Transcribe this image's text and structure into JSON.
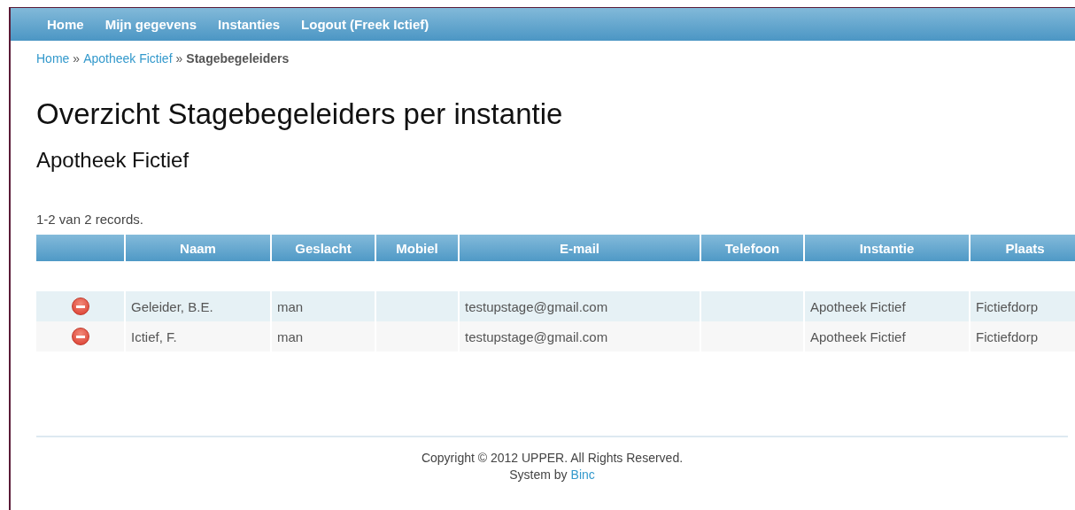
{
  "nav": [
    {
      "label": "Home"
    },
    {
      "label": "Mijn gegevens"
    },
    {
      "label": "Instanties"
    },
    {
      "label": "Logout (Freek Ictief)"
    }
  ],
  "breadcrumb": {
    "links": [
      "Home",
      "Apotheek Fictief"
    ],
    "separator": "»",
    "current": "Stagebegeleiders"
  },
  "title": "Overzicht Stagebegeleiders per instantie",
  "subtitle": "Apotheek Fictief",
  "summary": "1-2 van 2 records.",
  "table": {
    "columns": [
      "Naam",
      "Geslacht",
      "Mobiel",
      "E-mail",
      "Telefoon",
      "Instantie",
      "Plaats"
    ],
    "rows": [
      {
        "naam": "Geleider, B.E.",
        "geslacht": "man",
        "email": "testupstage@gmail.com",
        "instantie": "Apotheek Fictief",
        "plaats": "Fictiefdorp"
      },
      {
        "naam": "Ictief, F.",
        "geslacht": "man",
        "email": "testupstage@gmail.com",
        "instantie": "Apotheek Fictief",
        "plaats": "Fictiefdorp"
      }
    ]
  },
  "footer": {
    "copyright": "Copyright © 2012 UPPER. All Rights Reserved.",
    "system_prefix": "System by",
    "system_link": "Binc"
  }
}
